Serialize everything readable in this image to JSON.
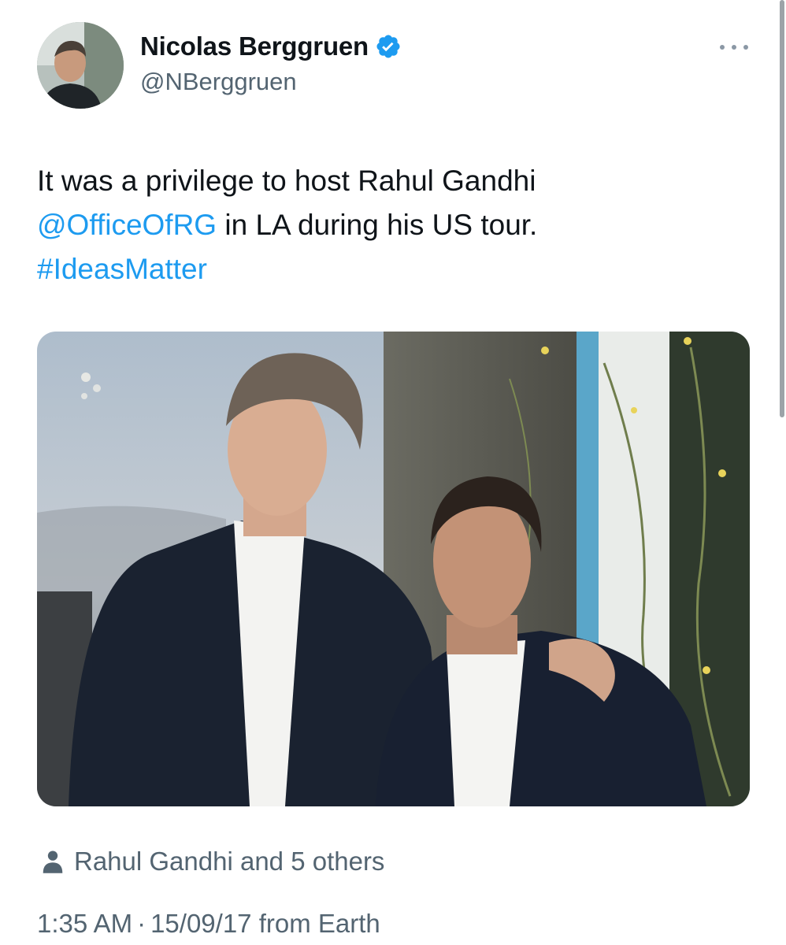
{
  "author": {
    "display_name": "Nicolas Berggruen",
    "handle": "@NBerggruen",
    "verified": true,
    "avatar_icon": "profile-photo"
  },
  "tweet": {
    "text_line1": "It was a privilege to host Rahul Gandhi",
    "mention": "@OfficeOfRG",
    "text_line2_rest": " in LA during his US tour.",
    "hashtag": "#IdeasMatter"
  },
  "tagged": {
    "icon": "person-icon",
    "text": "Rahul Gandhi and 5 others"
  },
  "meta": {
    "time": "1:35 AM",
    "separator": "·",
    "date": "15/09/17",
    "source": "from Earth"
  },
  "colors": {
    "link": "#1d9bf0",
    "secondary_text": "#536471",
    "primary_text": "#0f1419",
    "verified_badge": "#1d9bf0"
  }
}
